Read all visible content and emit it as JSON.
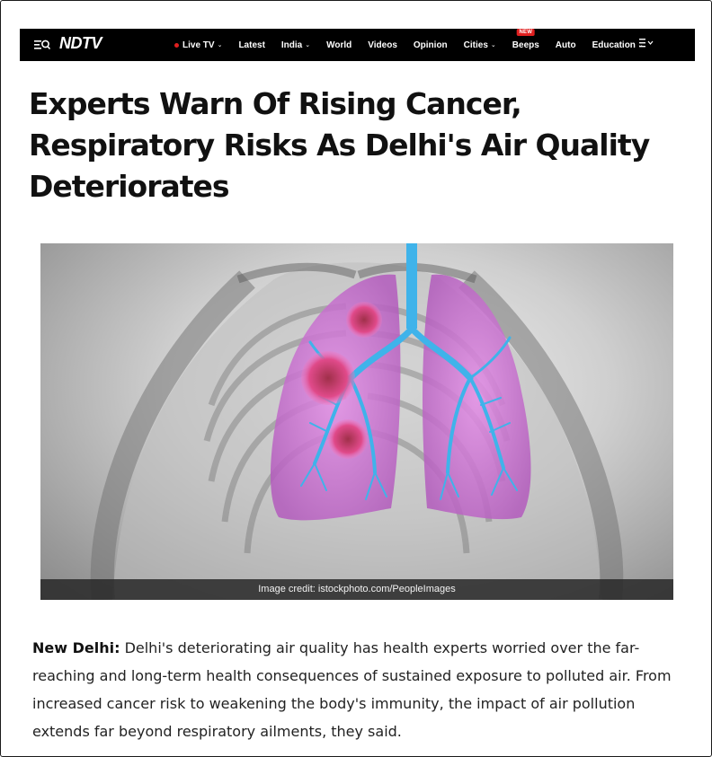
{
  "nav": {
    "logo": "NDTV",
    "items": [
      {
        "label": "Live TV",
        "live": true,
        "dropdown": true
      },
      {
        "label": "Latest",
        "dropdown": false
      },
      {
        "label": "India",
        "dropdown": true
      },
      {
        "label": "World",
        "dropdown": false
      },
      {
        "label": "Videos",
        "dropdown": false
      },
      {
        "label": "Opinion",
        "dropdown": false
      },
      {
        "label": "Cities",
        "dropdown": true
      },
      {
        "label": "Beeps",
        "dropdown": false,
        "badge": "NEW"
      },
      {
        "label": "Auto",
        "dropdown": false
      },
      {
        "label": "Education",
        "dropdown": true
      }
    ],
    "menu_icon": "menu-search-icon",
    "more_icon": "hamburger-icon"
  },
  "article": {
    "headline": "Experts Warn Of Rising Cancer, Respiratory Risks As Delhi's Air Quality Deteriorates",
    "image_credit": "Image credit: istockphoto.com/PeopleImages",
    "dateline": "New Delhi:",
    "lead": " Delhi's deteriorating air quality has health experts worried over the far-reaching and long-term health consequences of sustained exposure to polluted air. From increased cancer risk to weakening the body's immunity, the impact of air pollution extends far beyond respiratory ailments, they said."
  },
  "colors": {
    "nav_bg": "#000000",
    "live_dot": "#e02020",
    "badge": "#e02020",
    "lung_pink": "#d873d8",
    "airway_blue": "#3fb3ea"
  }
}
